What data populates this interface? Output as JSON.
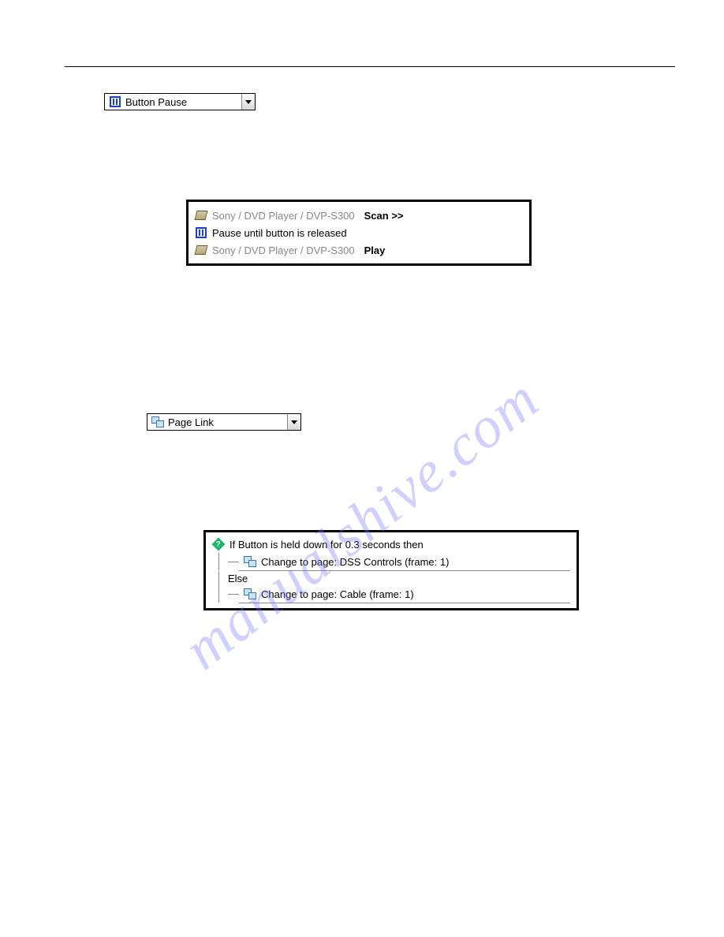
{
  "dropdown1": {
    "label": "Button Pause"
  },
  "dropdown2": {
    "label": "Page Link"
  },
  "actionList": {
    "row1_path": "Sony / DVD Player / DVP-S300",
    "row1_cmd": "Scan >>",
    "row2_text": "Pause until button is released",
    "row3_path": "Sony / DVD Player / DVP-S300",
    "row3_cmd": "Play"
  },
  "tree": {
    "if_text": "If Button is held down for 0.3 seconds then",
    "then_text": "Change to page: DSS Controls (frame: 1)",
    "else_label": "Else",
    "else_text": "Change to page: Cable (frame: 1)"
  },
  "watermark": "manualshive.com"
}
